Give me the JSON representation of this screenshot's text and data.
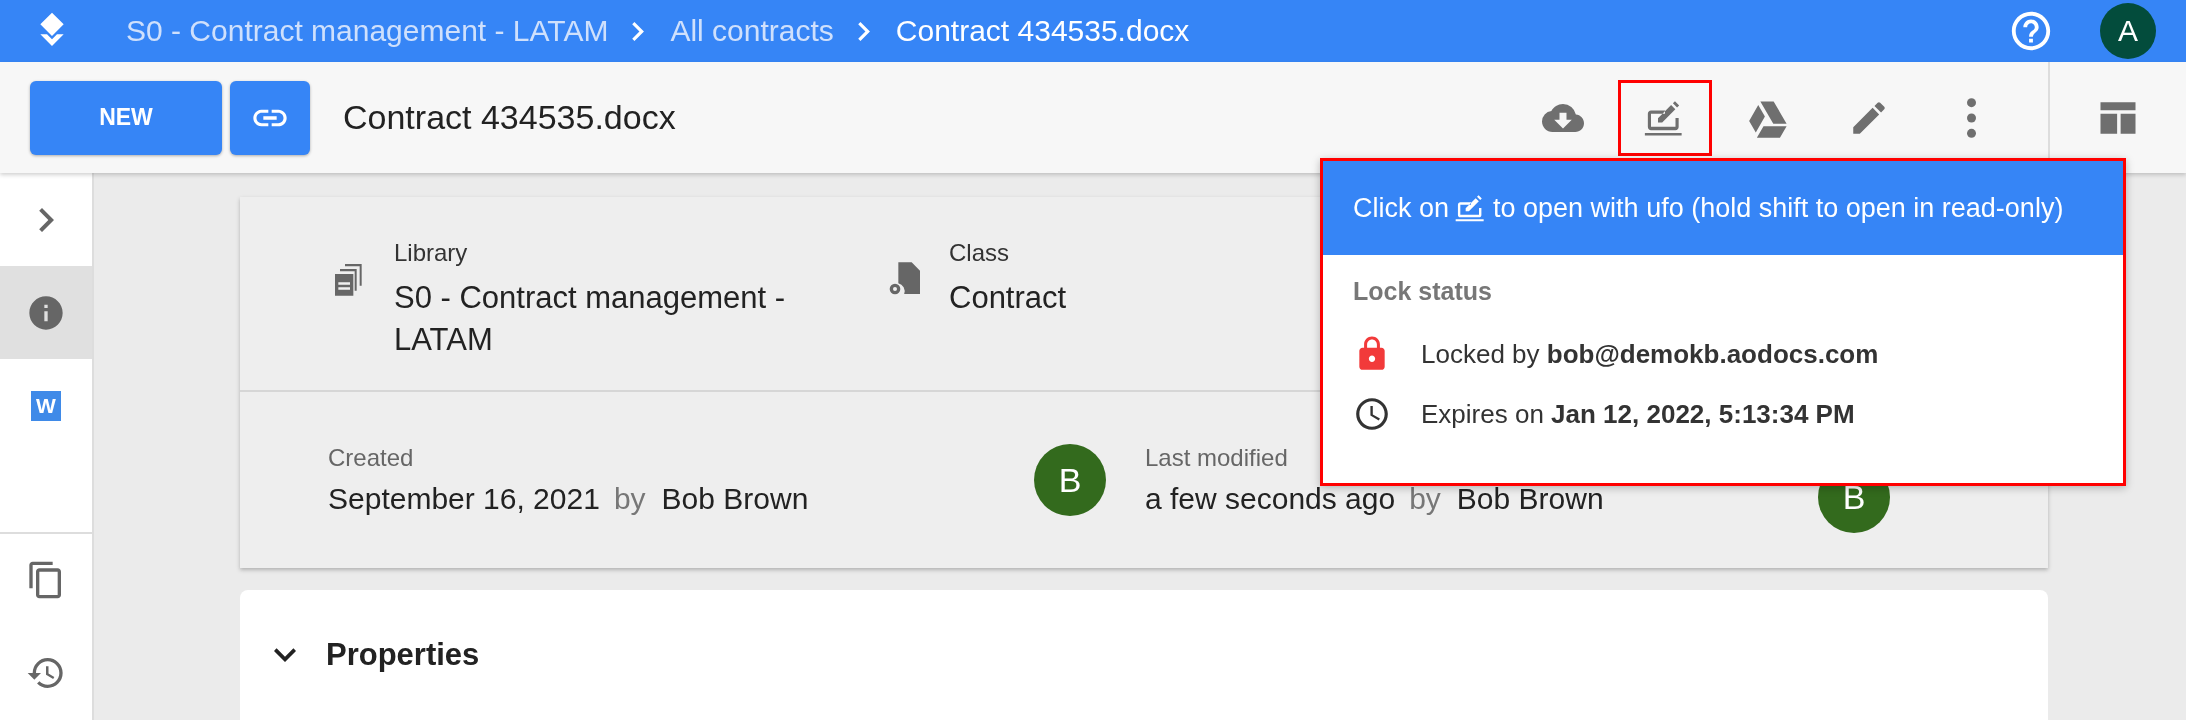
{
  "top_bar": {
    "breadcrumbs": [
      {
        "label": "S0 - Contract management - LATAM",
        "current": false
      },
      {
        "label": "All contracts",
        "current": false
      },
      {
        "label": "Contract 434535.docx",
        "current": true
      }
    ],
    "user_avatar": "A"
  },
  "toolbar": {
    "new_button": "NEW",
    "title": "Contract 434535.docx",
    "actions": [
      {
        "kind": "download",
        "highlighted": false
      },
      {
        "kind": "open-local",
        "highlighted": true
      },
      {
        "kind": "drive",
        "highlighted": false
      },
      {
        "kind": "edit",
        "highlighted": false
      },
      {
        "kind": "more",
        "highlighted": false
      }
    ]
  },
  "sidebar": {
    "items": [
      {
        "kind": "expand",
        "selected": false
      },
      {
        "kind": "info",
        "selected": true
      },
      {
        "kind": "word",
        "selected": false,
        "letter": "W"
      },
      {
        "kind": "copies",
        "selected": false
      },
      {
        "kind": "history",
        "selected": false
      }
    ]
  },
  "info_card": {
    "fields": [
      {
        "kind": "library",
        "label": "Library",
        "value": "S0 - Contract management - LATAM"
      },
      {
        "kind": "class",
        "label": "Class",
        "value": "Contract"
      }
    ],
    "audit": [
      {
        "label": "Created",
        "date": "September 16, 2021",
        "by": "by",
        "user": "Bob Brown",
        "avatar": "B"
      },
      {
        "label": "Last modified",
        "date": "a few seconds ago",
        "by": "by",
        "user": "Bob Brown",
        "avatar": "B"
      }
    ]
  },
  "properties": {
    "title": "Properties",
    "expanded": true
  },
  "popup": {
    "highlighted": true,
    "hint_before": "Click on",
    "hint_after": "to open with ufo (hold shift to open in read-only)",
    "section": "Lock status",
    "rows": [
      {
        "kind": "lock",
        "text": "Locked by **bob@demokb.aodocs.com**"
      },
      {
        "kind": "clock",
        "text": "Expires on **Jan 12, 2022, 5:13:34 PM**"
      }
    ]
  }
}
